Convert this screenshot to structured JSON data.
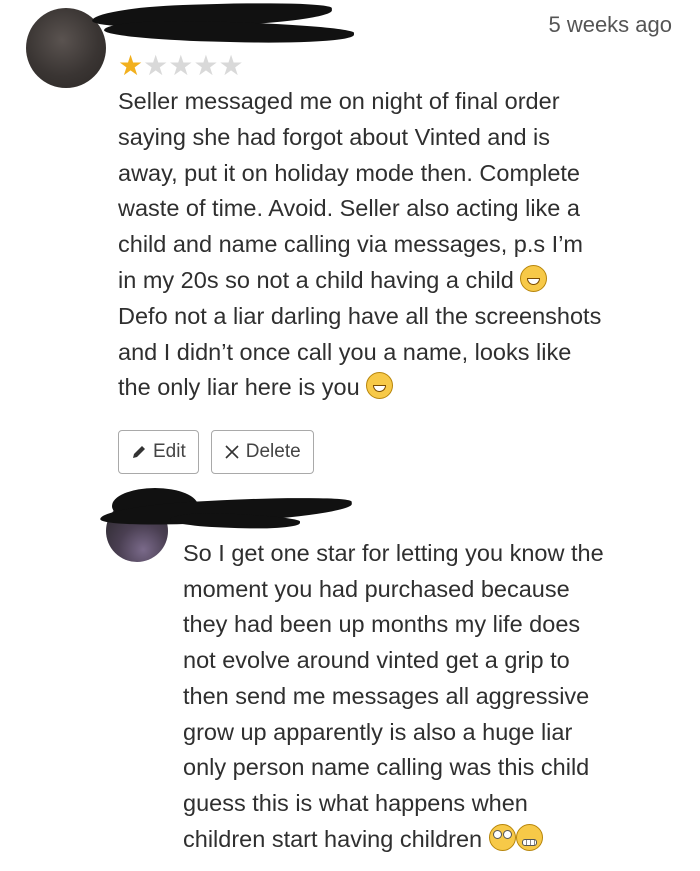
{
  "review": {
    "timestamp": "5 weeks ago",
    "rating": 1,
    "max_rating": 5,
    "lines": [
      "Seller messaged me on night of final order",
      "saying she had forgot about Vinted and is",
      "away, put it on holiday mode then. Complete",
      "waste of time. Avoid. Seller also acting like a",
      "child and name calling via messages, p.s I’m",
      "in my 20s so not a child having a child",
      "Defo not a liar darling have all the screenshots",
      "and I didn’t once call you a name, looks like",
      "the only liar here is you"
    ],
    "edit_label": "Edit",
    "delete_label": "Delete"
  },
  "reply": {
    "lines": [
      "So I get one star for letting you know the",
      "moment you had purchased because",
      "they had been up months my life does",
      "not evolve around vinted get a grip to",
      "then send me messages all aggressive",
      "grow up apparently is also a huge liar",
      "only person name calling was this child",
      "guess this is what happens when",
      "children start having children"
    ]
  },
  "icons": {
    "edit": "pencil-icon",
    "delete": "close-icon",
    "laugh": "rolling-laughing-emoji",
    "eyeroll": "eye-roll-emoji",
    "grimace": "grimacing-emoji"
  },
  "colors": {
    "star_filled": "#f2b01e",
    "star_empty": "#d9d9d9",
    "redaction": "#111111"
  }
}
